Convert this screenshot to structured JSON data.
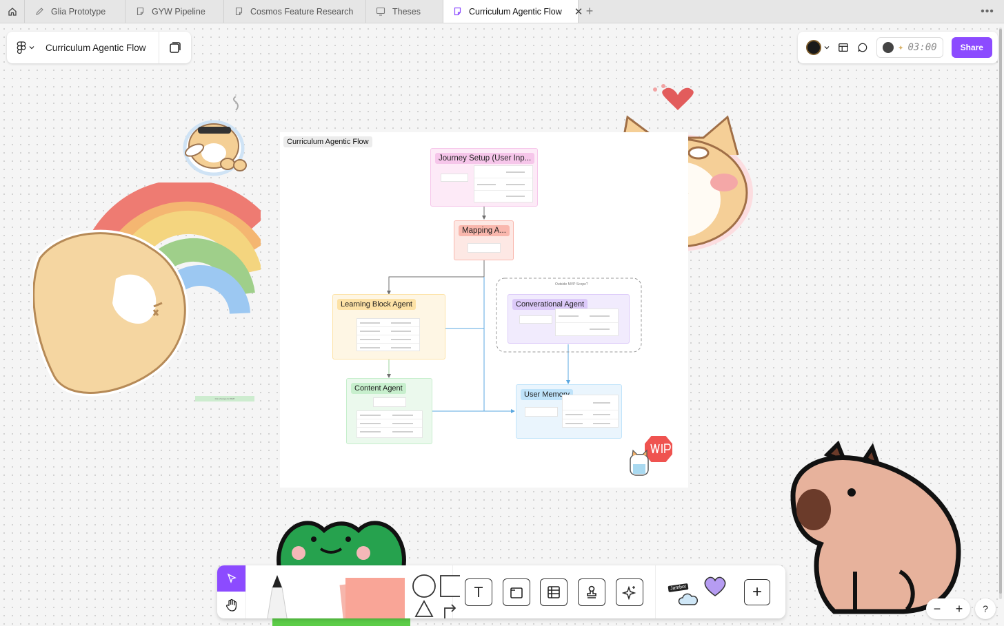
{
  "tabs": [
    {
      "label": "Glia Prototype",
      "icon": "pen-icon"
    },
    {
      "label": "GYW Pipeline",
      "icon": "file-icon"
    },
    {
      "label": "Cosmos Feature Research",
      "icon": "file-icon"
    },
    {
      "label": "Theses",
      "icon": "slides-icon"
    },
    {
      "label": "Curriculum Agentic Flow",
      "icon": "figjam-icon",
      "active": true
    }
  ],
  "header": {
    "file_title": "Curriculum Agentic Flow"
  },
  "right_bar": {
    "timer": "03:00",
    "share_label": "Share"
  },
  "board": {
    "section_label": "Curriculum Agentic Flow",
    "outside_mvp_label": "Outside MVP Scope?",
    "green_note": "Out of scope for MVP",
    "nodes": {
      "journey": {
        "title": "Journey Setup (User Inp...",
        "color": "#f6c6ea",
        "bg": "#fdeaf7"
      },
      "mapping": {
        "title": "Mapping A...",
        "color": "#f9b7ad",
        "bg": "#fde8e4"
      },
      "learning": {
        "title": "Learning Block Agent",
        "color": "#fde2a6",
        "bg": "#fef6e4"
      },
      "conversational": {
        "title": "Converational Agent",
        "color": "#dccaf9",
        "bg": "#f1ebfd"
      },
      "content": {
        "title": "Content Agent",
        "color": "#c7efcd",
        "bg": "#ebf9ed"
      },
      "memory": {
        "title": "User Memory",
        "color": "#bfe3fa",
        "bg": "#eaf5fd"
      }
    }
  },
  "toolbar": {
    "sticker_tag": "Jambot"
  },
  "zoom": {
    "minus": "−",
    "plus": "+"
  },
  "help": "?"
}
